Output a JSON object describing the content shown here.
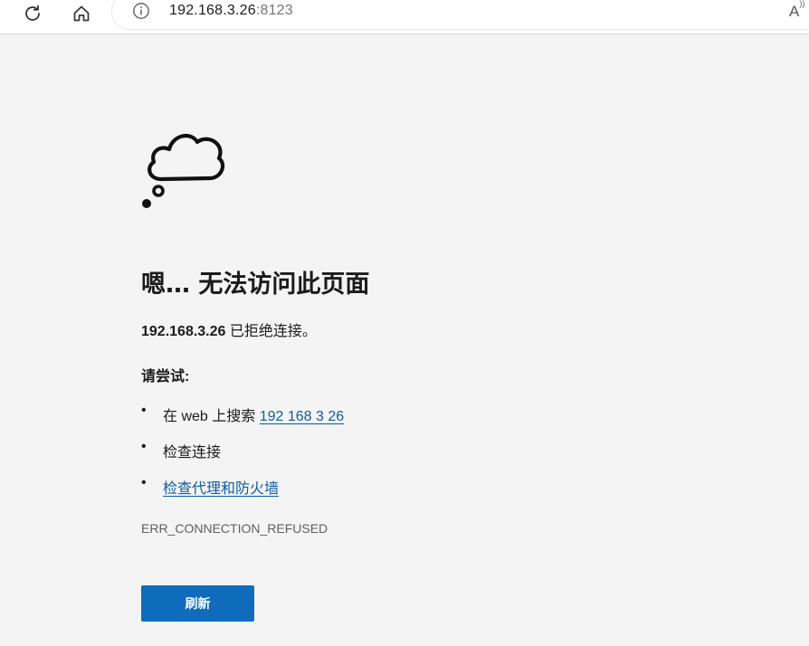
{
  "browser": {
    "reload_icon": "reload-icon",
    "home_icon": "home-icon",
    "info_icon": "info-icon",
    "url_host": "192.168.3.26",
    "url_port": ":8123",
    "read_aloud_label": "A",
    "read_aloud_sup": "))"
  },
  "error_page": {
    "illustration": "thought-cloud-icon",
    "title": "嗯… 无法访问此页面",
    "description_host": "192.168.3.26",
    "description_text": " 已拒绝连接。",
    "try_heading": "请尝试:",
    "suggestions": {
      "search_prefix": "在 web 上搜索 ",
      "search_link": "192 168 3 26",
      "check_connection": "检查连接",
      "check_proxy_link": "检查代理和防火墙"
    },
    "bullet": "•",
    "error_code": "ERR_CONNECTION_REFUSED",
    "refresh_label": "刷新"
  },
  "colors": {
    "background": "#f4f4f4",
    "link": "#0f5bab",
    "button": "#0f6cbd"
  }
}
